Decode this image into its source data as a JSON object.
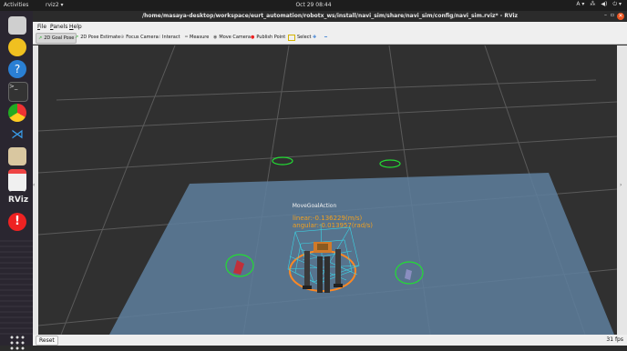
{
  "topbar": {
    "activities": "Activities",
    "app_name": "rviz2 ▾",
    "clock": "Oct 29  08:44"
  },
  "window": {
    "title": "/home/masaya-desktop/workspace/eurt_automation/robotx_ws/install/navi_sim/share/navi_sim/config/navi_sim.rviz* - RViz"
  },
  "menubar": {
    "items": [
      "File",
      "Panels",
      "Help"
    ]
  },
  "toolbar": {
    "tools": [
      {
        "label": "2D Goal Pose",
        "icon": "green-arrow-icon"
      },
      {
        "label": "2D Pose Estimate",
        "icon": "green-arrow-icon"
      },
      {
        "label": "Focus Camera",
        "icon": "crosshair-icon"
      },
      {
        "label": "Interact",
        "icon": "hand-icon"
      },
      {
        "label": "Measure",
        "icon": "ruler-icon"
      },
      {
        "label": "Move Camera",
        "icon": "camera-icon"
      },
      {
        "label": "Publish Point",
        "icon": "pin-icon"
      },
      {
        "label": "Select",
        "icon": "select-icon"
      }
    ]
  },
  "viewport": {
    "action_label": "MoveGoalAction",
    "linear_text": "linear:-0.136229(m/s)",
    "angular_text": "angular:-0.013957(rad/s)"
  },
  "statusbar": {
    "reset_label": "Reset",
    "fps": "31 fps"
  },
  "colors": {
    "accent": "#e95420",
    "plane": "#5e7f9e",
    "grid": "#5a5a5a",
    "marker_green": "#22dd33",
    "text_orange": "#f0a020"
  }
}
